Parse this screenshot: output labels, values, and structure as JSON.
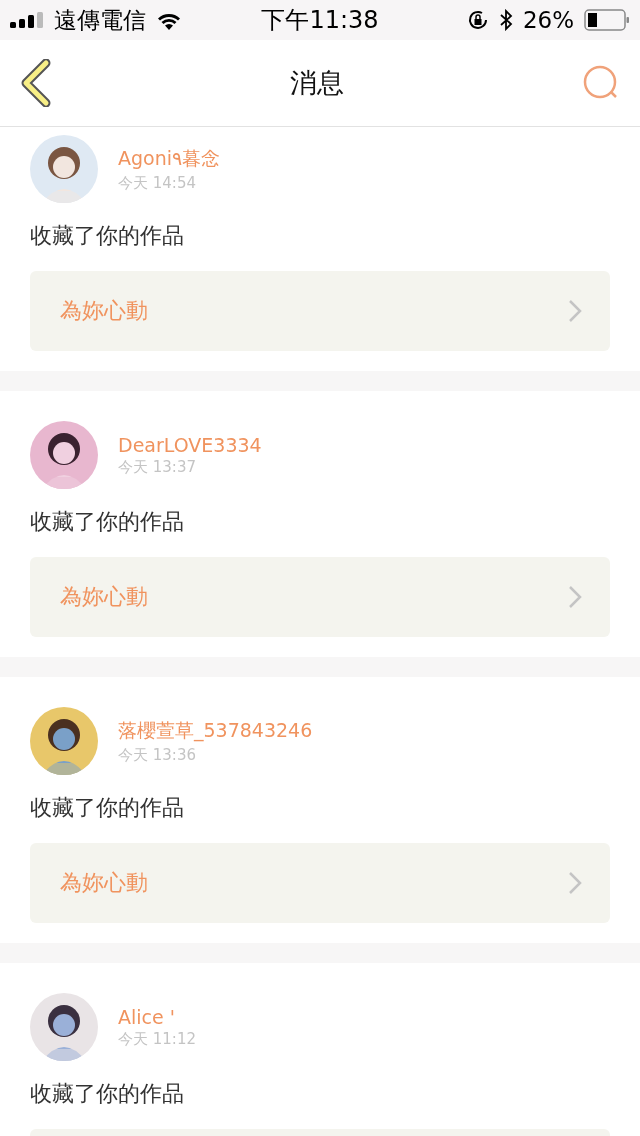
{
  "status_bar": {
    "carrier": "遠傳電信",
    "time": "下午11:38",
    "battery": "26%"
  },
  "nav": {
    "title": "消息"
  },
  "messages": [
    {
      "name": "Agoni٩暮念",
      "time": "今天 14:54",
      "action": "收藏了你的作品",
      "work": {
        "kind": "full",
        "title": "為妳心動"
      }
    },
    {
      "name": "DearLOVE3334",
      "time": "今天 13:37",
      "action": "收藏了你的作品",
      "work": {
        "kind": "full",
        "title": "為妳心動"
      }
    },
    {
      "name": "落櫻萱草_537843246",
      "time": "今天 13:36",
      "action": "收藏了你的作品",
      "work": {
        "kind": "full",
        "title": "為妳心動"
      }
    },
    {
      "name": "Alice '",
      "time": "今天 11:12",
      "action": "收藏了你的作品",
      "work": {
        "kind": "cut"
      }
    }
  ]
}
